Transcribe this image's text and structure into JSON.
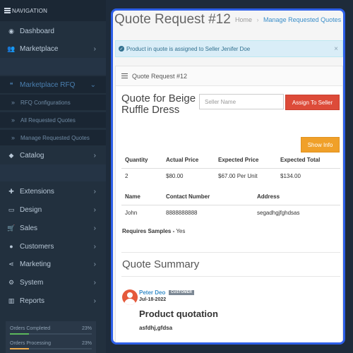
{
  "sidebar": {
    "header": "NAVIGATION",
    "items": [
      {
        "label": "Dashboard",
        "icon": "dashboard-icon",
        "glyph": "◉"
      },
      {
        "label": "Marketplace",
        "icon": "users-icon",
        "glyph": "👥",
        "chevron": "›"
      },
      {
        "label": "Marketplace RFQ",
        "icon": "quote-icon",
        "glyph": "❝",
        "chevron": "⌄"
      },
      {
        "label": "Catalog",
        "icon": "tag-icon",
        "glyph": "◆",
        "chevron": "›"
      },
      {
        "label": "Extensions",
        "icon": "puzzle-icon",
        "glyph": "✚",
        "chevron": "›"
      },
      {
        "label": "Design",
        "icon": "monitor-icon",
        "glyph": "▭",
        "chevron": "›"
      },
      {
        "label": "Sales",
        "icon": "cart-icon",
        "glyph": "🛒",
        "chevron": "›"
      },
      {
        "label": "Customers",
        "icon": "user-icon",
        "glyph": "●",
        "chevron": "›"
      },
      {
        "label": "Marketing",
        "icon": "share-icon",
        "glyph": "⋖",
        "chevron": "›"
      },
      {
        "label": "System",
        "icon": "gear-icon",
        "glyph": "⚙",
        "chevron": "›"
      },
      {
        "label": "Reports",
        "icon": "bar-chart-icon",
        "glyph": "▥",
        "chevron": "›"
      }
    ],
    "sub_items": [
      {
        "label": "RFQ Configurations"
      },
      {
        "label": "All Requested Quotes"
      },
      {
        "label": "Manage Requested Quotes"
      }
    ],
    "stats": [
      {
        "label": "Orders Completed",
        "value": "23%",
        "percent": 23,
        "color": "#5cb85c"
      },
      {
        "label": "Orders Processing",
        "value": "23%",
        "percent": 23,
        "color": "#f0ad4e"
      }
    ]
  },
  "header": {
    "title": "Quote Request #12",
    "breadcrumb": {
      "home": "Home",
      "separator": "›",
      "current": "Manage Requested Quotes"
    }
  },
  "alert": {
    "text": "Product in quote is assigned to Seller Jenifer Doe",
    "close": "×"
  },
  "card": {
    "heading": "Quote Request #12",
    "quote_title": "Quote for Beige Ruffle Dress",
    "seller_placeholder": "Seller Name",
    "assign_label": "Assign To Seller",
    "show_info_label": "Show Info",
    "price_table": {
      "headers": [
        "Quantity",
        "Actual Price",
        "Expected Price",
        "Expected Total"
      ],
      "row": [
        "2",
        "$80.00",
        "$67.00 Per Unit",
        "$134.00"
      ]
    },
    "seller_table": {
      "headers": [
        "Name",
        "Contact Number",
        "Address"
      ],
      "row": [
        "John",
        "8888888888",
        "segadhgjfghdsas"
      ]
    },
    "requires_samples": {
      "label": "Requires Samples -",
      "value": "Yes"
    },
    "summary_title": "Quote Summary",
    "comment": {
      "author": "Peter Deo",
      "role": "CUSTOMER",
      "date": "Jul-18-2022",
      "title": "Product quotation",
      "body": "asfdhj,gfdsa"
    }
  },
  "colors": {
    "accent": "#3a8ec9",
    "danger": "#dd4b39",
    "warning": "#f0a029",
    "highlight_border": "#2d5fe8"
  }
}
